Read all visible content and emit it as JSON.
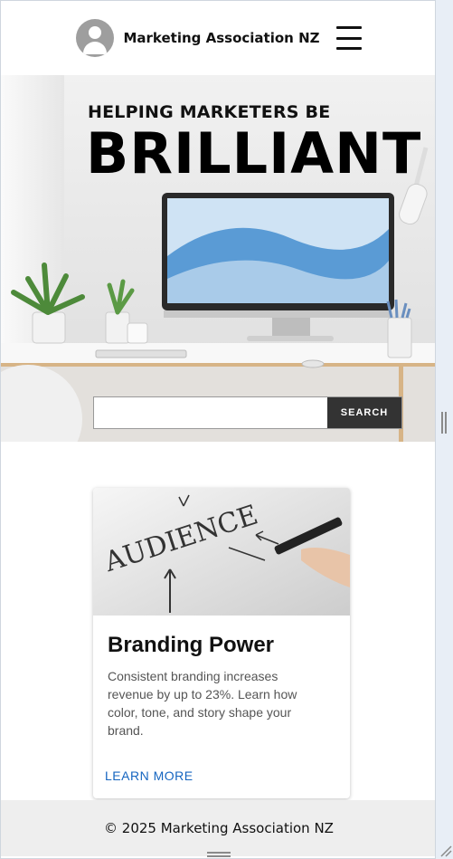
{
  "header": {
    "brand_name": "Marketing Association NZ",
    "avatar_icon": "user-avatar-icon",
    "menu_icon": "hamburger-menu-icon"
  },
  "hero": {
    "subtitle": "HELPING MARKETERS BE",
    "title": "BRILLIANT",
    "background_image": "white desk with monitor and plants",
    "search": {
      "value": "",
      "placeholder": "",
      "button_label": "SEARCH"
    }
  },
  "card": {
    "image": "hand writing AUDIENCE with arrows on whiteboard",
    "image_text": "AUDIENCE",
    "title": "Branding Power",
    "text": "Consistent branding increases revenue by up to 23%. Learn how color, tone, and story shape your brand.",
    "link_label": "LEARN MORE"
  },
  "footer": {
    "text": "© 2025 Marketing Association NZ"
  },
  "colors": {
    "page_bg": "#ffffff",
    "outer_bg": "#e8eef6",
    "search_button": "#333333",
    "link": "#1565c0",
    "footer_bg": "#eeeeee"
  }
}
